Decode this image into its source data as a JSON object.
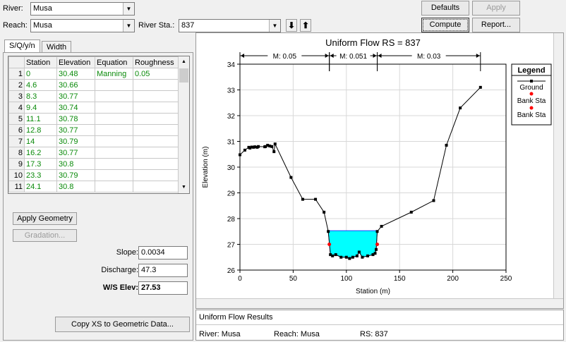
{
  "toolbar": {
    "river_label": "River:",
    "river_value": "Musa",
    "reach_label": "Reach:",
    "reach_value": "Musa",
    "river_sta_label": "River Sta.:",
    "river_sta_value": "837",
    "defaults_button": "Defaults",
    "apply_button": "Apply",
    "compute_button": "Compute",
    "report_button": "Report..."
  },
  "tabs": [
    "S/Q/y/n",
    "Width"
  ],
  "table": {
    "columns": [
      "Station",
      "Elevation",
      "Equation",
      "Roughness"
    ],
    "rows": [
      {
        "n": "1",
        "station": "0",
        "elevation": "30.48",
        "equation": "Manning",
        "roughness": "0.05"
      },
      {
        "n": "2",
        "station": "4.6",
        "elevation": "30.66",
        "equation": "",
        "roughness": ""
      },
      {
        "n": "3",
        "station": "8.3",
        "elevation": "30.77",
        "equation": "",
        "roughness": ""
      },
      {
        "n": "4",
        "station": "9.4",
        "elevation": "30.74",
        "equation": "",
        "roughness": ""
      },
      {
        "n": "5",
        "station": "11.1",
        "elevation": "30.78",
        "equation": "",
        "roughness": ""
      },
      {
        "n": "6",
        "station": "12.8",
        "elevation": "30.77",
        "equation": "",
        "roughness": ""
      },
      {
        "n": "7",
        "station": "14",
        "elevation": "30.79",
        "equation": "",
        "roughness": ""
      },
      {
        "n": "8",
        "station": "16.2",
        "elevation": "30.77",
        "equation": "",
        "roughness": ""
      },
      {
        "n": "9",
        "station": "17.3",
        "elevation": "30.8",
        "equation": "",
        "roughness": ""
      },
      {
        "n": "10",
        "station": "23.3",
        "elevation": "30.79",
        "equation": "",
        "roughness": ""
      },
      {
        "n": "11",
        "station": "24.1",
        "elevation": "30.8",
        "equation": "",
        "roughness": ""
      }
    ]
  },
  "buttons": {
    "apply_geometry": "Apply Geometry",
    "gradation": "Gradation...",
    "copy_xs": "Copy XS to Geometric Data..."
  },
  "params": {
    "slope_label": "Slope:",
    "slope_value": "0.0034",
    "discharge_label": "Discharge:",
    "discharge_value": "47.3",
    "ws_label": "W/S Elev:",
    "ws_value": "27.53"
  },
  "results": {
    "title": "Uniform Flow Results",
    "river": "River: Musa",
    "reach": "Reach: Musa",
    "rs": "RS: 837"
  },
  "chart_data": {
    "type": "line",
    "title": "Uniform Flow RS = 837",
    "xlabel": "Station (m)",
    "ylabel": "Elevation (m)",
    "xlim": [
      0,
      250
    ],
    "ylim": [
      26,
      34
    ],
    "xticks": [
      "0",
      "50",
      "100",
      "150",
      "200",
      "250"
    ],
    "yticks": [
      "26",
      "27",
      "28",
      "29",
      "30",
      "31",
      "32",
      "33",
      "34"
    ],
    "grid": true,
    "legend_title": "Legend",
    "legend": [
      "Ground",
      "Bank Sta",
      "Bank Sta"
    ],
    "manning_zones": [
      {
        "label": "M: 0.05",
        "from": 0,
        "to": 84
      },
      {
        "label": "M: 0.051",
        "from": 84,
        "to": 129
      },
      {
        "label": "M: 0.03",
        "from": 129,
        "to": 226
      }
    ],
    "ground": {
      "x": [
        0,
        4.6,
        8.3,
        9.4,
        11.1,
        12.8,
        14,
        16.2,
        17.3,
        23.3,
        24.1,
        26,
        28,
        30,
        32,
        33,
        48,
        59,
        71,
        79,
        83,
        85,
        87,
        90,
        95,
        100,
        103,
        106,
        110,
        112,
        115,
        120,
        125,
        127,
        128,
        129,
        133,
        161,
        182,
        194,
        207,
        226
      ],
      "y": [
        30.48,
        30.66,
        30.77,
        30.74,
        30.78,
        30.77,
        30.79,
        30.77,
        30.8,
        30.79,
        30.8,
        30.85,
        30.82,
        30.8,
        30.6,
        30.9,
        29.6,
        28.75,
        28.75,
        28.25,
        27.5,
        26.6,
        26.55,
        26.6,
        26.5,
        26.5,
        26.45,
        26.5,
        26.55,
        26.7,
        26.5,
        26.55,
        26.6,
        26.65,
        26.8,
        27.5,
        27.7,
        28.25,
        28.7,
        30.85,
        32.3,
        33.1
      ]
    },
    "bank_stations": [
      {
        "x": 84,
        "y": 27.0
      },
      {
        "x": 129,
        "y": 27.0
      }
    ],
    "water_surface": 27.53,
    "colors": {
      "water": "#00ffff",
      "bank": "#ff0000",
      "ground": "#000000"
    }
  }
}
